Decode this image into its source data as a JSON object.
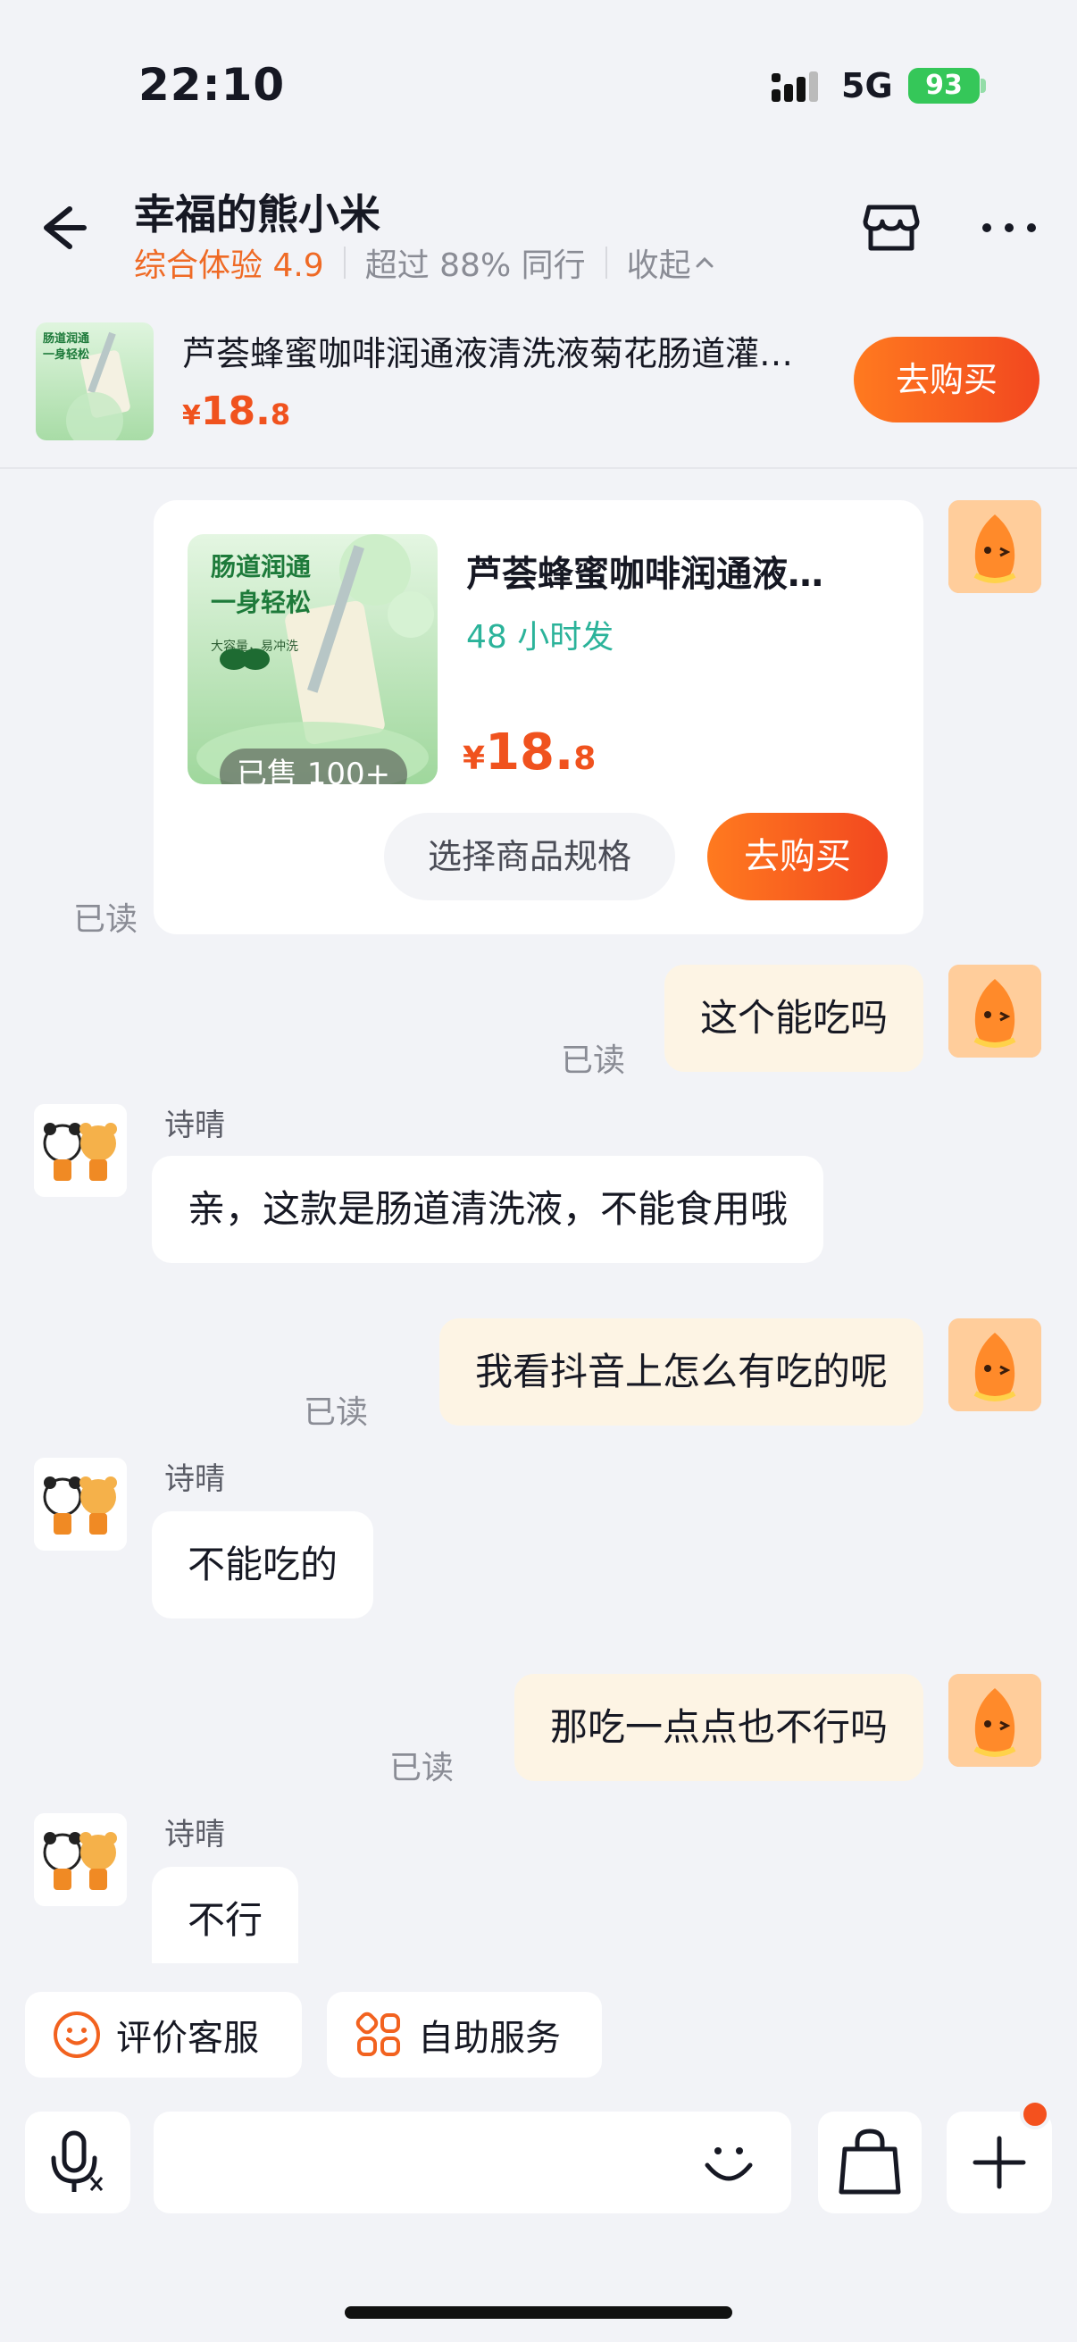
{
  "status_bar": {
    "time": "22:10",
    "network": "5G",
    "battery": "93"
  },
  "header": {
    "shop_name": "幸福的熊小米",
    "score": "综合体验 4.9",
    "rank": "超过 88% 同行",
    "collapse": "收起"
  },
  "product_strip": {
    "title": "芦荟蜂蜜咖啡润通液清洗液菊花肠道灌…",
    "price_symbol": "¥",
    "price_int": "18.",
    "price_dec": "8",
    "buy_label": "去购买",
    "thumb_text": [
      "肠道润通",
      "一身轻松"
    ]
  },
  "product_card": {
    "title": "芦荟蜂蜜咖啡润通液…",
    "shipping": "48 小时发",
    "sold": "已售 100+",
    "price_symbol": "¥",
    "price_int": "18.",
    "price_dec": "8",
    "spec_label": "选择商品规格",
    "buy_label": "去购买",
    "thumb_text": [
      "肠道润通",
      "一身轻松",
      "大容量，易冲洗"
    ],
    "read": "已读"
  },
  "messages": [
    {
      "from": "me",
      "text": "这个能吃吗",
      "read": "已读"
    },
    {
      "from": "agent",
      "sender": "诗晴",
      "text": "亲，这款是肠道清洗液，不能食用哦"
    },
    {
      "from": "me",
      "text": "我看抖音上怎么有吃的呢",
      "read": "已读"
    },
    {
      "from": "agent",
      "sender": "诗晴",
      "text": "不能吃的"
    },
    {
      "from": "me",
      "text": "那吃一点点也不行吗",
      "read": "已读"
    },
    {
      "from": "agent",
      "sender": "诗晴",
      "text": "不行"
    }
  ],
  "quick_actions": {
    "rate": "评价客服",
    "self_service": "自助服务"
  },
  "input": {
    "placeholder": ""
  },
  "colors": {
    "accent": "#f2471f",
    "score": "#ef6a25",
    "shipping": "#2bb39a",
    "my_bubble": "#fdf4e4"
  }
}
